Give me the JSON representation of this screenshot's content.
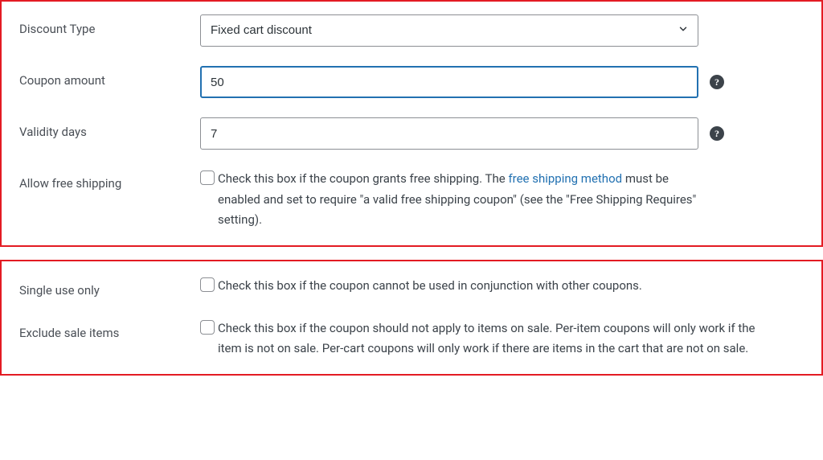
{
  "section1": {
    "discountType": {
      "label": "Discount Type",
      "value": "Fixed cart discount"
    },
    "couponAmount": {
      "label": "Coupon amount",
      "value": "50"
    },
    "validityDays": {
      "label": "Validity days",
      "value": "7"
    },
    "freeShipping": {
      "label": "Allow free shipping",
      "desc_before": "Check this box if the coupon grants free shipping. The ",
      "link_text": "free shipping method",
      "desc_after": " must be enabled and set to require \"a valid free shipping coupon\" (see the \"Free Shipping Requires\" setting)."
    }
  },
  "section2": {
    "singleUse": {
      "label": "Single use only",
      "desc": "Check this box if the coupon cannot be used in conjunction with other coupons."
    },
    "excludeSale": {
      "label": "Exclude sale items",
      "desc": "Check this box if the coupon should not apply to items on sale. Per-item coupons will only work if the item is not on sale. Per-cart coupons will only work if there are items in the cart that are not on sale."
    }
  },
  "help_glyph": "?"
}
